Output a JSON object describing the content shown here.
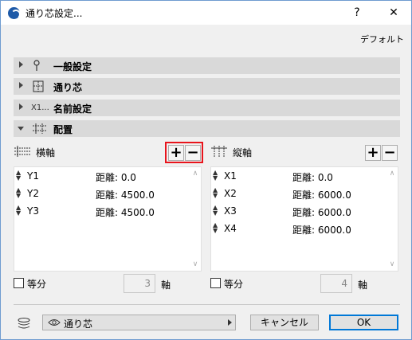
{
  "window": {
    "title": "通り芯設定...",
    "help_label": "?",
    "close_label": "✕"
  },
  "defaults_label": "デフォルト",
  "sections": [
    {
      "label": "一般設定",
      "icon_text": "",
      "expanded": false
    },
    {
      "label": "通り芯",
      "icon_text": "",
      "expanded": false
    },
    {
      "label": "名前設定",
      "icon_text": "X1...",
      "expanded": false
    },
    {
      "label": "配置",
      "icon_text": "",
      "expanded": true
    }
  ],
  "horizontal": {
    "label": "横軸",
    "add_label": "+",
    "remove_label": "−",
    "rows": [
      {
        "name": "Y1",
        "dist": "距離: 0.0"
      },
      {
        "name": "Y2",
        "dist": "距離: 4500.0"
      },
      {
        "name": "Y3",
        "dist": "距離: 4500.0"
      }
    ],
    "equal_label": "等分",
    "count": "3",
    "unit": "軸"
  },
  "vertical": {
    "label": "縦軸",
    "add_label": "+",
    "remove_label": "−",
    "rows": [
      {
        "name": "X1",
        "dist": "距離: 0.0"
      },
      {
        "name": "X2",
        "dist": "距離: 6000.0"
      },
      {
        "name": "X3",
        "dist": "距離: 6000.0"
      },
      {
        "name": "X4",
        "dist": "距離: 6000.0"
      }
    ],
    "equal_label": "等分",
    "count": "4",
    "unit": "軸"
  },
  "footer": {
    "layer_name": "通り芯",
    "cancel_label": "キャンセル",
    "ok_label": "OK"
  },
  "colors": {
    "highlight": "#e8141c",
    "accent": "#0078d7",
    "section_bg": "#d9d9d9"
  }
}
